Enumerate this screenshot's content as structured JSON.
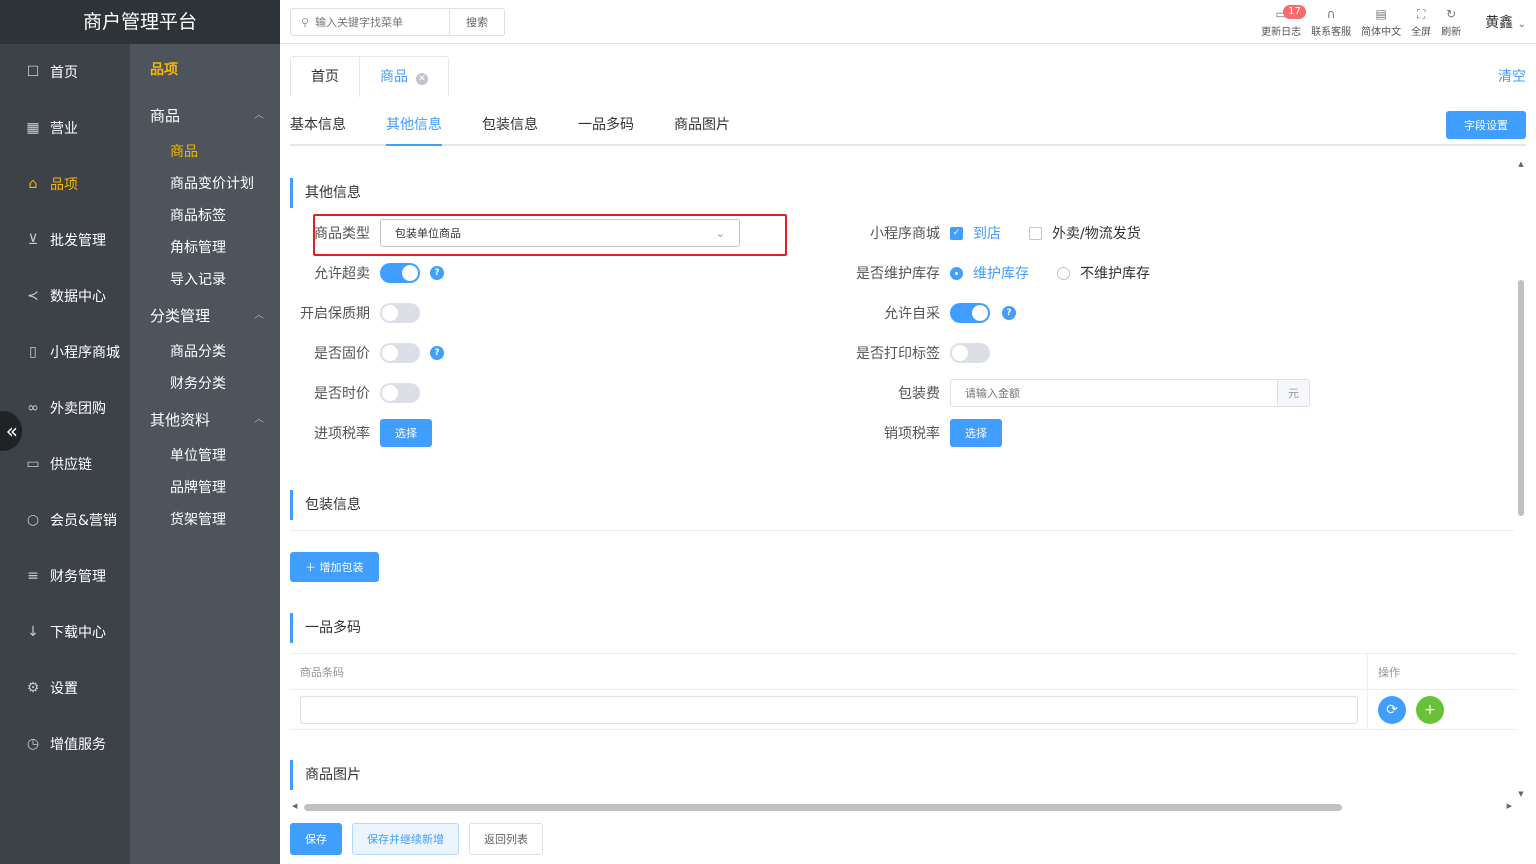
{
  "app": {
    "title": "商户管理平台"
  },
  "nav": {
    "items": [
      {
        "label": "首页",
        "icon": "home-icon"
      },
      {
        "label": "营业",
        "icon": "calendar-icon"
      },
      {
        "label": "品项",
        "icon": "bag-icon",
        "active": true
      },
      {
        "label": "批发管理",
        "icon": "cart-icon"
      },
      {
        "label": "数据中心",
        "icon": "share-icon"
      },
      {
        "label": "小程序商城",
        "icon": "phone-icon"
      },
      {
        "label": "外卖团购",
        "icon": "bike-icon"
      },
      {
        "label": "供应链",
        "icon": "truck-icon"
      },
      {
        "label": "会员&营销",
        "icon": "user-icon"
      },
      {
        "label": "财务管理",
        "icon": "database-icon"
      },
      {
        "label": "下载中心",
        "icon": "download-icon"
      },
      {
        "label": "设置",
        "icon": "gear-icon"
      },
      {
        "label": "增值服务",
        "icon": "clock-icon"
      }
    ],
    "collapse_glyph": "«"
  },
  "subnav": {
    "title": "品项",
    "groups": [
      {
        "label": "商品",
        "items": [
          "商品",
          "商品变价计划",
          "商品标签",
          "角标管理",
          "导入记录"
        ]
      },
      {
        "label": "分类管理",
        "items": [
          "商品分类",
          "财务分类"
        ]
      },
      {
        "label": "其他资料",
        "items": [
          "单位管理",
          "品牌管理",
          "货架管理"
        ]
      }
    ]
  },
  "topbar": {
    "search_placeholder": "输入关键字找菜单",
    "search_button": "搜索",
    "tools": [
      {
        "label": "更新日志",
        "icon": "message-icon",
        "badge": "17"
      },
      {
        "label": "联系客服",
        "icon": "headset-icon"
      },
      {
        "label": "简体中文",
        "icon": "language-icon"
      },
      {
        "label": "全屏",
        "icon": "fullscreen-icon"
      },
      {
        "label": "刷新",
        "icon": "refresh-icon"
      }
    ],
    "user": "黄鑫"
  },
  "pagetabs": {
    "items": [
      "首页",
      "商品"
    ],
    "clear": "清空"
  },
  "sectabs": {
    "items": [
      "基本信息",
      "其他信息",
      "包装信息",
      "一品多码",
      "商品图片"
    ],
    "active": "其他信息",
    "field_settings": "字段设置"
  },
  "other_info": {
    "title": "其他信息",
    "product_type": {
      "label": "商品类型",
      "value": "包装单位商品"
    },
    "allow_oversell": {
      "label": "允许超卖",
      "on": true
    },
    "shelf_life": {
      "label": "开启保质期",
      "on": false
    },
    "fixed_price": {
      "label": "是否固价",
      "on": false
    },
    "time_price": {
      "label": "是否时价",
      "on": false
    },
    "input_tax": {
      "label": "进项税率",
      "button": "选择"
    },
    "mini_mall": {
      "label": "小程序商城",
      "options": [
        {
          "text": "到店",
          "checked": true
        },
        {
          "text": "外卖/物流发货",
          "checked": false
        }
      ]
    },
    "maintain_stock": {
      "label": "是否维护库存",
      "options": [
        {
          "text": "维护库存",
          "selected": true
        },
        {
          "text": "不维护库存",
          "selected": false
        }
      ]
    },
    "self_purchase": {
      "label": "允许自采",
      "on": true
    },
    "print_label": {
      "label": "是否打印标签",
      "on": false
    },
    "packing_fee": {
      "label": "包装费",
      "placeholder": "请输入金额",
      "unit": "元"
    },
    "output_tax": {
      "label": "销项税率",
      "button": "选择"
    }
  },
  "packaging": {
    "title": "包装信息",
    "add_button": "增加包装"
  },
  "multicode": {
    "title": "一品多码",
    "col_barcode": "商品条码",
    "col_actions": "操作"
  },
  "images": {
    "title": "商品图片"
  },
  "footer": {
    "save": "保存",
    "save_continue": "保存并继续新增",
    "back": "返回列表"
  },
  "colors": {
    "primary": "#409eff",
    "active_nav": "#f7b500",
    "add_green": "#67c23a",
    "highlight_red": "#e02020"
  }
}
